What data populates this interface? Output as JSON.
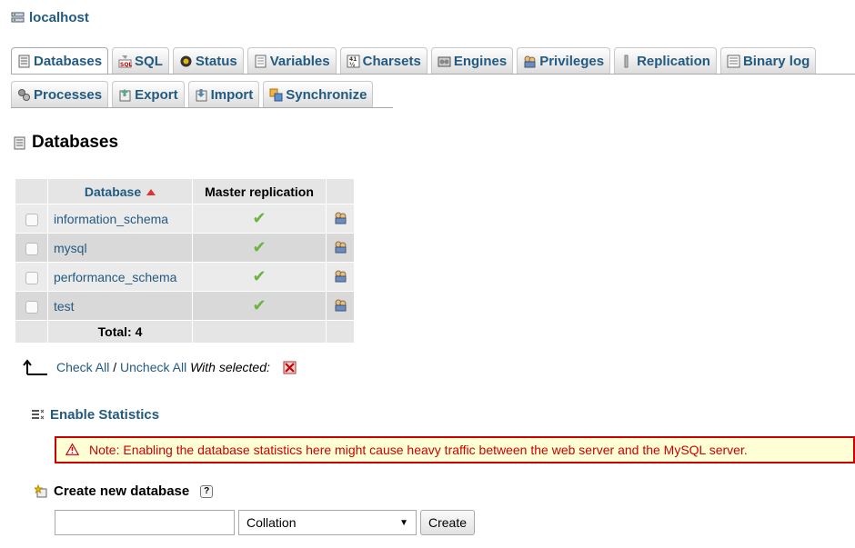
{
  "server": {
    "label": "localhost",
    "icon": "server-icon"
  },
  "tabs_row1": [
    {
      "label": "Databases",
      "icon": "databases-icon",
      "active": true
    },
    {
      "label": "SQL",
      "icon": "sql-icon"
    },
    {
      "label": "Status",
      "icon": "status-icon"
    },
    {
      "label": "Variables",
      "icon": "variables-icon"
    },
    {
      "label": "Charsets",
      "icon": "charsets-icon"
    },
    {
      "label": "Engines",
      "icon": "engines-icon"
    },
    {
      "label": "Privileges",
      "icon": "privileges-icon"
    },
    {
      "label": "Replication",
      "icon": "replication-icon"
    },
    {
      "label": "Binary log",
      "icon": "binary-log-icon"
    }
  ],
  "tabs_row2": [
    {
      "label": "Processes",
      "icon": "processes-icon"
    },
    {
      "label": "Export",
      "icon": "export-icon"
    },
    {
      "label": "Import",
      "icon": "import-icon"
    },
    {
      "label": "Synchronize",
      "icon": "synchronize-icon"
    }
  ],
  "page_title": "Databases",
  "table": {
    "headers": {
      "database": "Database",
      "master_replication": "Master replication"
    },
    "rows": [
      {
        "name": "information_schema",
        "replicated": true
      },
      {
        "name": "mysql",
        "replicated": true
      },
      {
        "name": "performance_schema",
        "replicated": true
      },
      {
        "name": "test",
        "replicated": true
      }
    ],
    "total": "Total: 4",
    "check_mark": "✔"
  },
  "check_all": {
    "check_all": "Check All",
    "separator": " / ",
    "uncheck_all": "Uncheck All",
    "with_selected": "With selected:"
  },
  "statistics": {
    "label": "Enable Statistics"
  },
  "notice": {
    "text": "Note: Enabling the database statistics here might cause heavy traffic between the web server and the MySQL server."
  },
  "create": {
    "title": "Create new database",
    "help": "?",
    "input_value": "",
    "collation": "Collation",
    "button": "Create"
  },
  "colors": {
    "link": "#235a81",
    "notice_border": "#cc0000",
    "notice_bg": "#ffffd5",
    "check": "#6cb33f"
  }
}
